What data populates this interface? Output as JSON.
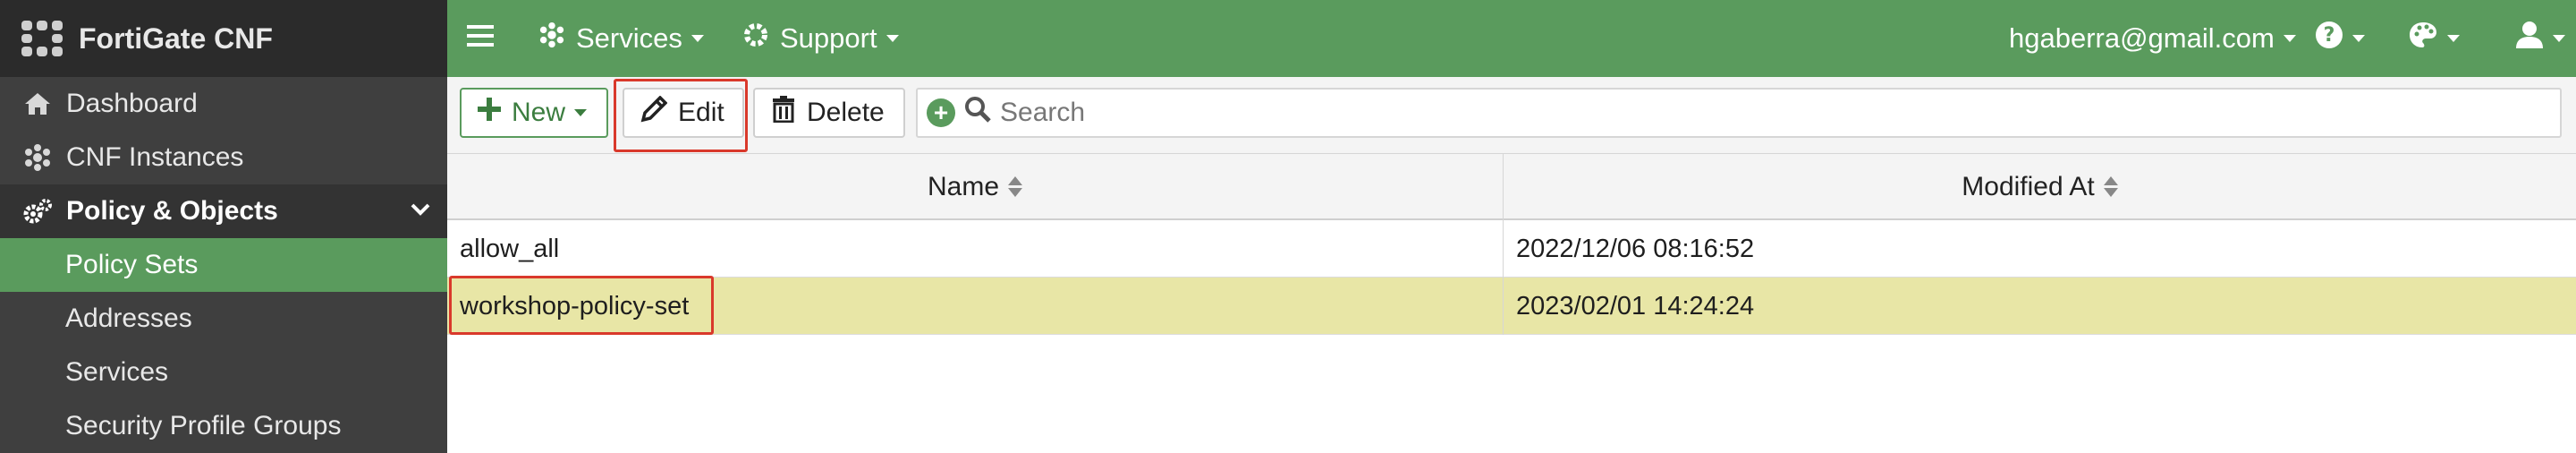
{
  "brand": {
    "title": "FortiGate CNF"
  },
  "sidebar": {
    "items": [
      {
        "label": "Dashboard",
        "icon": "home-icon"
      },
      {
        "label": "CNF Instances",
        "icon": "cluster-icon"
      },
      {
        "label": "Policy & Objects",
        "icon": "cogs-icon"
      },
      {
        "label": "Policy Sets"
      },
      {
        "label": "Addresses"
      },
      {
        "label": "Services"
      },
      {
        "label": "Security Profile Groups"
      }
    ]
  },
  "topbar": {
    "services_label": "Services",
    "support_label": "Support",
    "user_email": "hgaberra@gmail.com"
  },
  "toolbar": {
    "new_label": "New",
    "edit_label": "Edit",
    "delete_label": "Delete",
    "search_placeholder": "Search"
  },
  "table": {
    "columns": [
      "Name",
      "Modified At"
    ],
    "rows": [
      {
        "name": "allow_all",
        "modified": "2022/12/06 08:16:52"
      },
      {
        "name": "workshop-policy-set",
        "modified": "2023/02/01 14:24:24"
      }
    ]
  },
  "colors": {
    "accent_green": "#5a9b5d",
    "sidebar_bg": "#3f3f3f",
    "selected_row": "#e8e6a6",
    "highlight_red": "#d9392b"
  }
}
